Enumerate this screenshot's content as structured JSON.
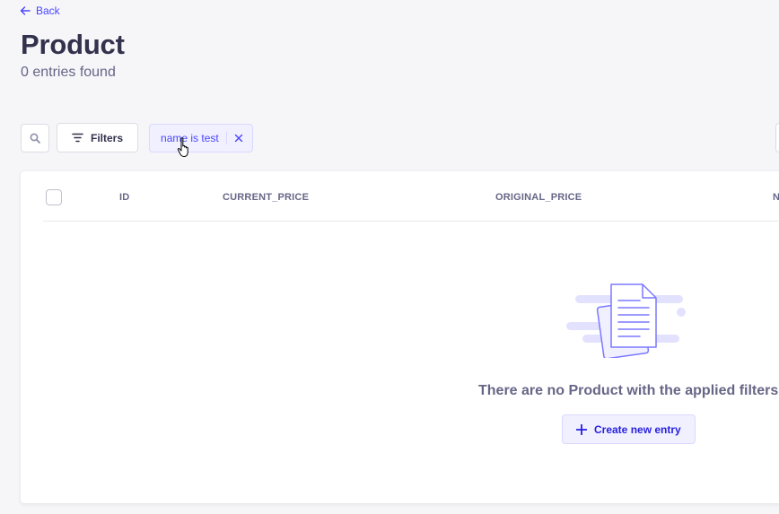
{
  "nav": {
    "back_label": "Back"
  },
  "header": {
    "title": "Product",
    "subtitle": "0 entries found"
  },
  "toolbar": {
    "filters_label": "Filters",
    "active_filter": "name is test"
  },
  "table": {
    "columns": [
      "ID",
      "CURRENT_PRICE",
      "ORIGINAL_PRICE",
      "N"
    ]
  },
  "empty_state": {
    "message": "There are no Product with the applied filters...",
    "create_label": "Create new entry"
  },
  "icons": {
    "back": "arrow-left-icon",
    "search": "search-icon",
    "filter": "filter-icon",
    "remove_filter": "close-icon",
    "create": "plus-icon",
    "illustration": "documents-illustration"
  },
  "colors": {
    "accent": "#4945ff",
    "background": "#f6f6f9",
    "text": "#32324d",
    "muted": "#666687"
  }
}
